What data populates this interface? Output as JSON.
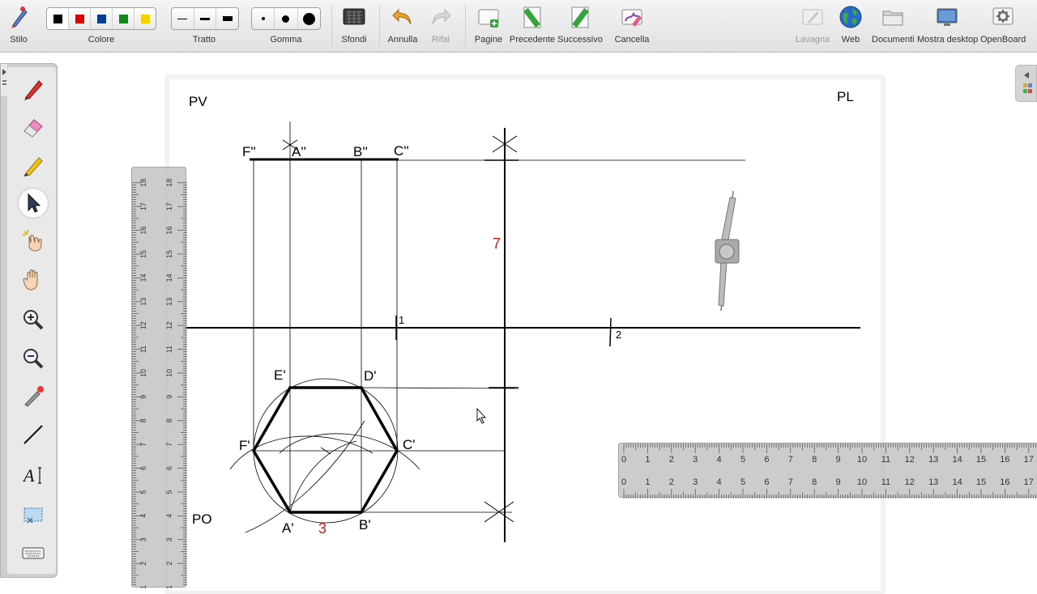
{
  "toolbar": {
    "stylus": "Stilo",
    "color": "Colore",
    "stroke": "Tratto",
    "eraser": "Gomma",
    "backgrounds": "Sfondi",
    "undo": "Annulla",
    "redo": "Rifai",
    "pages": "Pagine",
    "previous": "Precedente",
    "next": "Successivo",
    "clear": "Cancella",
    "board": "Lavagna",
    "web": "Web",
    "documents": "Documenti",
    "show_desktop": "Mostra desktop",
    "app": "OpenBoard",
    "colors": [
      "#000000",
      "#e00000",
      "#0a3d91",
      "#118a1a",
      "#f2d300"
    ]
  },
  "palette": {
    "tools": [
      "pen-icon",
      "eraser-icon",
      "marker-icon",
      "selector-icon",
      "interact-icon",
      "hand-icon",
      "zoom-in-icon",
      "zoom-out-icon",
      "laser-pointer-icon",
      "line-icon",
      "text-icon",
      "capture-icon",
      "keyboard-icon"
    ],
    "active": "selector-icon"
  },
  "drawing": {
    "label_pv": "PV",
    "label_pl": "PL",
    "label_po": "PO",
    "label_f2": "F''",
    "label_a2": "A''",
    "label_b2": "B''",
    "label_c2": "C''",
    "label_e1": "E'",
    "label_d1": "D'",
    "label_f1": "F'",
    "label_c1": "C'",
    "label_a1": "A'",
    "label_b1": "B'",
    "mark_1": "1",
    "mark_2": "2",
    "dim_height": "7",
    "dim_side": "3"
  },
  "rulers": {
    "vertical_numbers": [
      "1",
      "2",
      "3",
      "4",
      "5",
      "6",
      "7",
      "8",
      "9",
      "10",
      "11",
      "12",
      "13",
      "14",
      "15",
      "16",
      "17",
      "18"
    ],
    "horizontal_numbers": [
      "0",
      "1",
      "2",
      "3",
      "4",
      "5",
      "6",
      "7",
      "8",
      "9",
      "10",
      "11",
      "12",
      "13",
      "14",
      "15",
      "16",
      "17"
    ]
  }
}
